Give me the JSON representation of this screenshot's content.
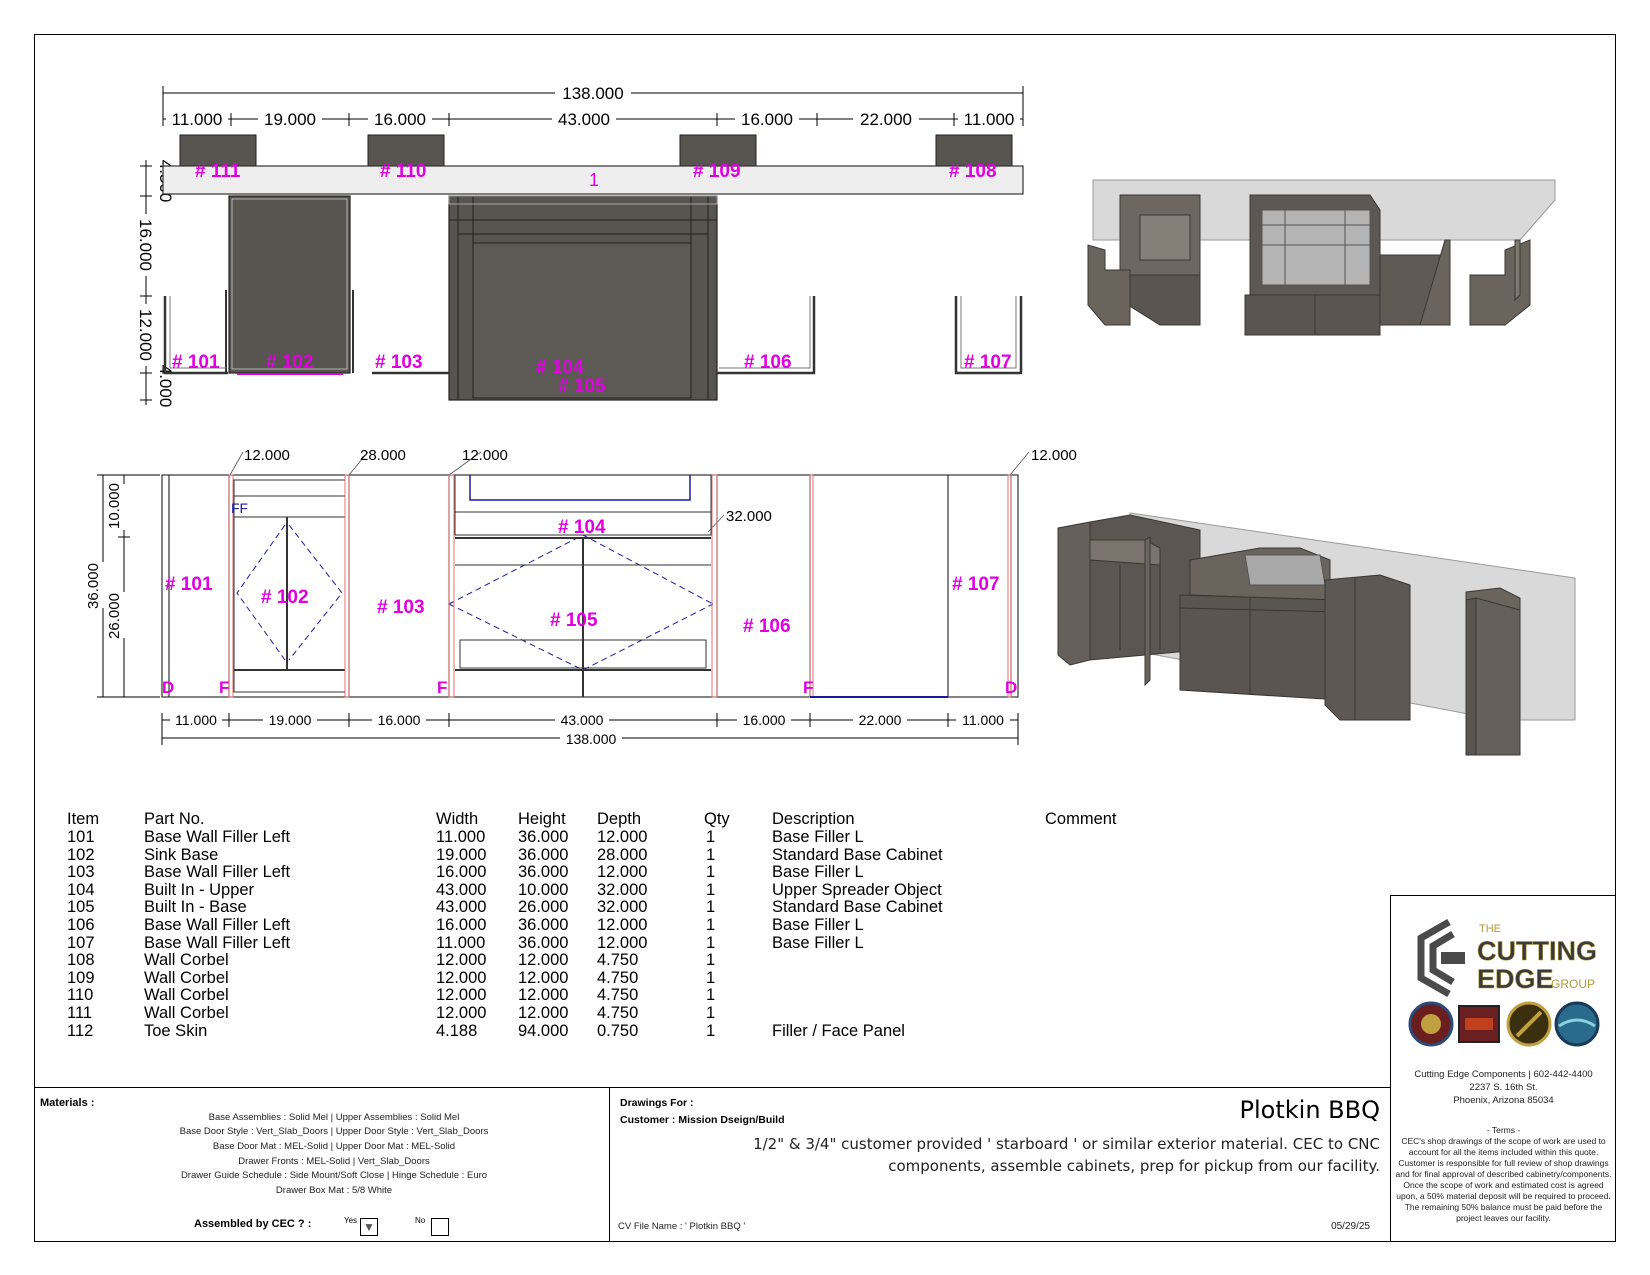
{
  "plan_dims": {
    "overall": "138.000",
    "top_segments": [
      "11.000",
      "19.000",
      "16.000",
      "43.000",
      "16.000",
      "22.000",
      "11.000"
    ],
    "side": [
      "4.500",
      "16.000",
      "12.000",
      "4.000"
    ]
  },
  "plan_labels": {
    "l111": "# 111",
    "l110": "# 110",
    "l109": "# 109",
    "l108": "# 108",
    "l1": "1",
    "l101": "# 101",
    "l102": "# 102",
    "l103": "# 103",
    "l104": "# 104",
    "l105": "# 105",
    "l106": "# 106",
    "l107": "# 107"
  },
  "elev_dims": {
    "top_depths": [
      "12.000",
      "28.000",
      "12.000",
      "12.000"
    ],
    "d32": "32.000",
    "side": [
      "10.000",
      "36.000",
      "26.000"
    ],
    "bottom_segments": [
      "11.000",
      "19.000",
      "16.000",
      "43.000",
      "16.000",
      "22.000",
      "11.000"
    ],
    "overall": "138.000"
  },
  "elev_labels": {
    "l101": "# 101",
    "l102": "# 102",
    "l103": "# 103",
    "l104": "# 104",
    "l105": "# 105",
    "l106": "# 106",
    "l107": "# 107",
    "ff": "FF",
    "d_left": "D",
    "f1": "F",
    "f2": "F",
    "f3": "F",
    "d_right": "D"
  },
  "parts_table": {
    "headers": [
      "Item",
      "Part No.",
      "Width",
      "Height",
      "Depth",
      "Qty",
      "Description",
      "Comment"
    ],
    "rows": [
      [
        "101",
        "Base Wall Filler Left",
        "11.000",
        "36.000",
        "12.000",
        "1",
        "Base Filler L",
        ""
      ],
      [
        "102",
        "Sink Base",
        "19.000",
        "36.000",
        "28.000",
        "1",
        "Standard Base Cabinet",
        ""
      ],
      [
        "103",
        "Base Wall Filler Left",
        "16.000",
        "36.000",
        "12.000",
        "1",
        "Base Filler L",
        ""
      ],
      [
        "104",
        "Built In - Upper",
        "43.000",
        "10.000",
        "32.000",
        "1",
        "Upper Spreader Object",
        ""
      ],
      [
        "105",
        "Built In - Base",
        "43.000",
        "26.000",
        "32.000",
        "1",
        "Standard Base Cabinet",
        ""
      ],
      [
        "106",
        "Base Wall Filler Left",
        "16.000",
        "36.000",
        "12.000",
        "1",
        "Base Filler L",
        ""
      ],
      [
        "107",
        "Base Wall Filler Left",
        "11.000",
        "36.000",
        "12.000",
        "1",
        "Base Filler L",
        ""
      ],
      [
        "108",
        "Wall Corbel",
        "12.000",
        "12.000",
        "4.750",
        "1",
        "",
        ""
      ],
      [
        "109",
        "Wall Corbel",
        "12.000",
        "12.000",
        "4.750",
        "1",
        "",
        ""
      ],
      [
        "110",
        "Wall Corbel",
        "12.000",
        "12.000",
        "4.750",
        "1",
        "",
        ""
      ],
      [
        "111",
        "Wall Corbel",
        "12.000",
        "12.000",
        "4.750",
        "1",
        "",
        ""
      ],
      [
        "112",
        "Toe Skin",
        "4.188",
        "94.000",
        "0.750",
        "1",
        "Filler / Face Panel",
        ""
      ]
    ]
  },
  "materials": {
    "label": "Materials :",
    "lines": [
      "Base Assemblies : Solid Mel  | Upper Assemblies : Solid Mel",
      "Base Door Style :  Vert_Slab_Doors  | Upper Door Style :  Vert_Slab_Doors",
      "Base Door Mat :  MEL-Solid  | Upper Door Mat :  MEL-Solid",
      "Drawer Fronts :  MEL-Solid  |  Vert_Slab_Doors",
      "Drawer Guide Schedule :   Side Mount/Soft Close  | Hinge Schedule :   Euro",
      "Drawer Box Mat :  5/8 White"
    ],
    "assembled": "Assembled by CEC ? :",
    "yes": "Yes",
    "no": "No"
  },
  "drawing_info": {
    "drawings_for": "Drawings For :",
    "customer": "Customer : Mission Dseign/Build",
    "project": "Plotkin BBQ",
    "note": "1/2\" & 3/4\" customer provided ' starboard ' or similar exterior material. CEC to CNC components, assemble cabinets, prep for pickup from our facility.",
    "cv_file": "CV File Name : ' Plotkin BBQ '",
    "date": "05/29/25"
  },
  "company": {
    "the": "THE",
    "name1": "CUTTING",
    "name2": "EDGE",
    "name3": "GROUP",
    "contact": "Cutting Edge Components | 602-442-4400",
    "street": "2237 S. 16th St.",
    "city": "Phoenix, Arizona 85034",
    "terms_title": "- Terms -",
    "terms": "CEC's shop drawings of the scope of work are used to account for all the items included within this quote. Customer is responsible for full review of shop drawings and for final approval of described cabinetry/components. Once the scope of work and estimated cost is agreed upon, a 50% material deposit will be required to proceed. The remaining 50% balance must be paid before the project leaves our facility."
  },
  "colors": {
    "label": "#e000e0",
    "cabinet": "#58544f",
    "cabinet_light": "#857f78",
    "panel": "#d9d9d9"
  }
}
